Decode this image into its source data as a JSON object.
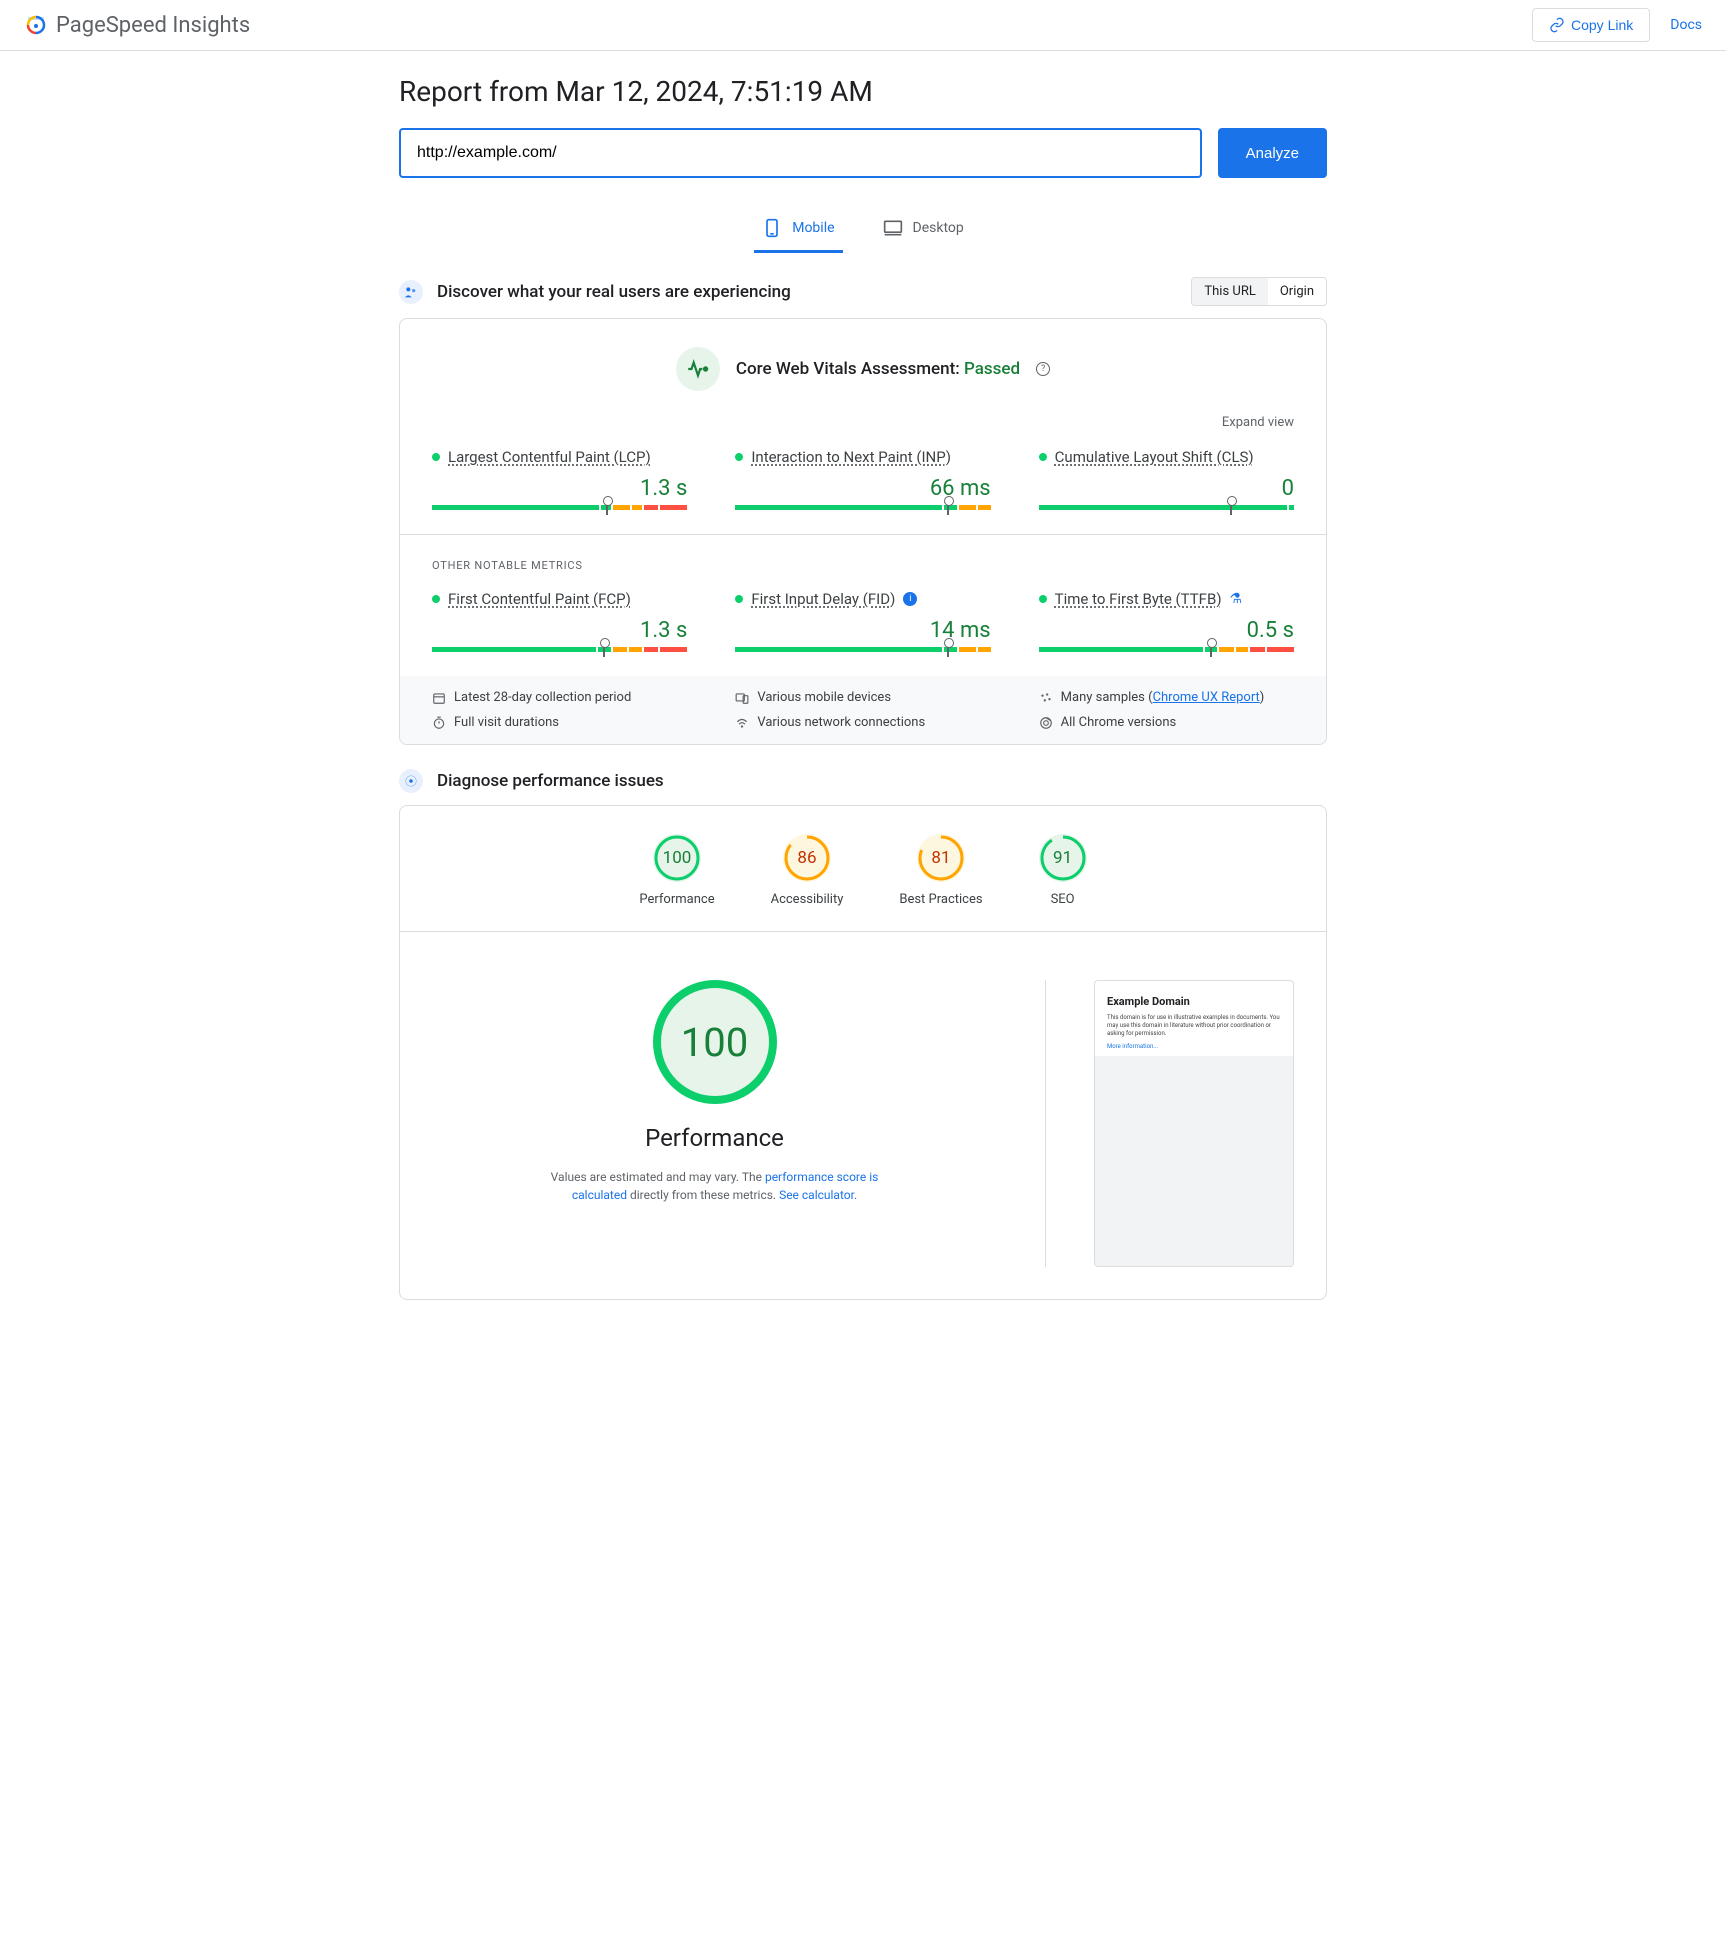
{
  "header": {
    "logo_text": "PageSpeed Insights",
    "copy_link": "Copy Link",
    "docs": "Docs"
  },
  "report": {
    "title": "Report from Mar 12, 2024, 7:51:19 AM",
    "url_value": "http://example.com/",
    "analyze": "Analyze"
  },
  "tabs": {
    "mobile": "Mobile",
    "desktop": "Desktop"
  },
  "crux": {
    "section_title": "Discover what your real users are experiencing",
    "seg_url": "This URL",
    "seg_origin": "Origin",
    "assessment_label": "Core Web Vitals Assessment: ",
    "assessment_result": "Passed",
    "expand": "Expand view",
    "other_label": "OTHER NOTABLE METRICS",
    "metrics": {
      "lcp": {
        "name": "Largest Contentful Paint (LCP)",
        "value": "1.3 s",
        "segs": [
          68,
          4,
          7,
          4,
          6,
          11
        ],
        "marker": 68
      },
      "inp": {
        "name": "Interaction to Next Paint (INP)",
        "value": "66 ms",
        "segs": [
          83,
          5,
          7,
          5
        ],
        "marker": 83
      },
      "cls": {
        "name": "Cumulative Layout Shift (CLS)",
        "value": "0",
        "segs": [
          98,
          2
        ],
        "marker": 75
      },
      "fcp": {
        "name": "First Contentful Paint (FCP)",
        "value": "1.3 s",
        "segs": [
          67,
          5,
          6,
          5,
          6,
          11
        ],
        "marker": 67
      },
      "fid": {
        "name": "First Input Delay (FID)",
        "value": "14 ms",
        "segs": [
          83,
          5,
          7,
          5
        ],
        "marker": 83
      },
      "ttfb": {
        "name": "Time to First Byte (TTFB)",
        "value": "0.5 s",
        "segs": [
          67,
          5,
          6,
          5,
          6,
          11
        ],
        "marker": 67
      }
    },
    "footer": {
      "period": "Latest 28-day collection period",
      "devices": "Various mobile devices",
      "samples_prefix": "Many samples (",
      "samples_link": "Chrome UX Report",
      "samples_suffix": ")",
      "durations": "Full visit durations",
      "network": "Various network connections",
      "chrome": "All Chrome versions"
    }
  },
  "diag": {
    "section_title": "Diagnose performance issues",
    "gauges": {
      "perf": {
        "score": "100",
        "label": "Performance"
      },
      "a11y": {
        "score": "86",
        "label": "Accessibility"
      },
      "bp": {
        "score": "81",
        "label": "Best Practices"
      },
      "seo": {
        "score": "91",
        "label": "SEO"
      }
    },
    "big": {
      "score": "100",
      "label": "Performance"
    },
    "disclaimer_1": "Values are estimated and may vary. The ",
    "disclaimer_link1": "performance score is calculated",
    "disclaimer_2": " directly from these metrics. ",
    "disclaimer_link2": "See calculator.",
    "preview": {
      "title": "Example Domain",
      "body": "This domain is for use in illustrative examples in documents. You may use this domain in literature without prior coordination or asking for permission.",
      "more": "More information..."
    }
  }
}
